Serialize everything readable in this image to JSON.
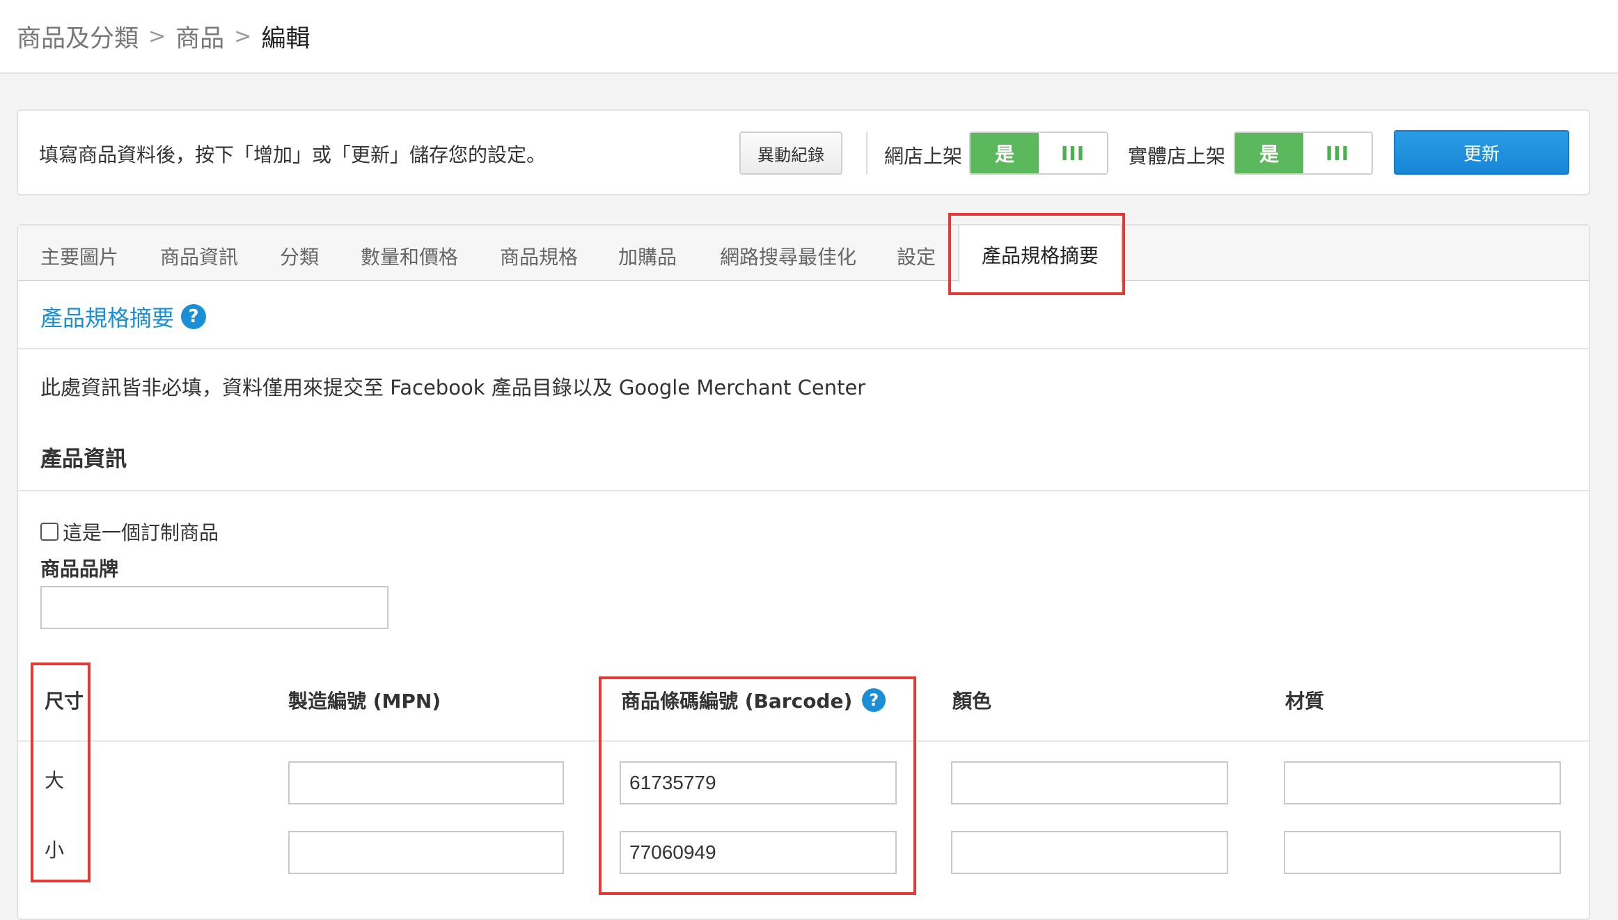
{
  "breadcrumb": [
    "商品及分類",
    "商品",
    "編輯"
  ],
  "notice": {
    "text": "填寫商品資料後，按下「增加」或「更新」儲存您的設定。",
    "history_label": "異動紀錄",
    "online_label": "網店上架",
    "offline_label": "實體店上架",
    "toggle_yes": "是",
    "toggle_no_icon": "III",
    "update_label": "更新"
  },
  "tabs": [
    "主要圖片",
    "商品資訊",
    "分類",
    "數量和價格",
    "商品規格",
    "加購品",
    "網路搜尋最佳化",
    "設定",
    "產品規格摘要"
  ],
  "section": {
    "title": "產品規格摘要",
    "help_icon": "?",
    "info": "此處資訊皆非必填，資料僅用來提交至 Facebook 產品目錄以及 Google Merchant Center",
    "heading": "產品資訊",
    "custom_checkbox_label": "這是一個訂制商品",
    "brand_label": "商品品牌",
    "brand_value": ""
  },
  "table": {
    "headers": [
      "尺寸",
      "製造編號 (MPN)",
      "商品條碼編號 (Barcode)",
      "顏色",
      "材質"
    ],
    "rows": [
      {
        "size": "大",
        "mpn": "",
        "barcode": "61735779",
        "color": "",
        "material": ""
      },
      {
        "size": "小",
        "mpn": "",
        "barcode": "77060949",
        "color": "",
        "material": ""
      }
    ]
  },
  "colors": {
    "accent_blue": "#1a8fd6",
    "toggle_green": "#5cb85c",
    "highlight_red": "#e53935"
  }
}
